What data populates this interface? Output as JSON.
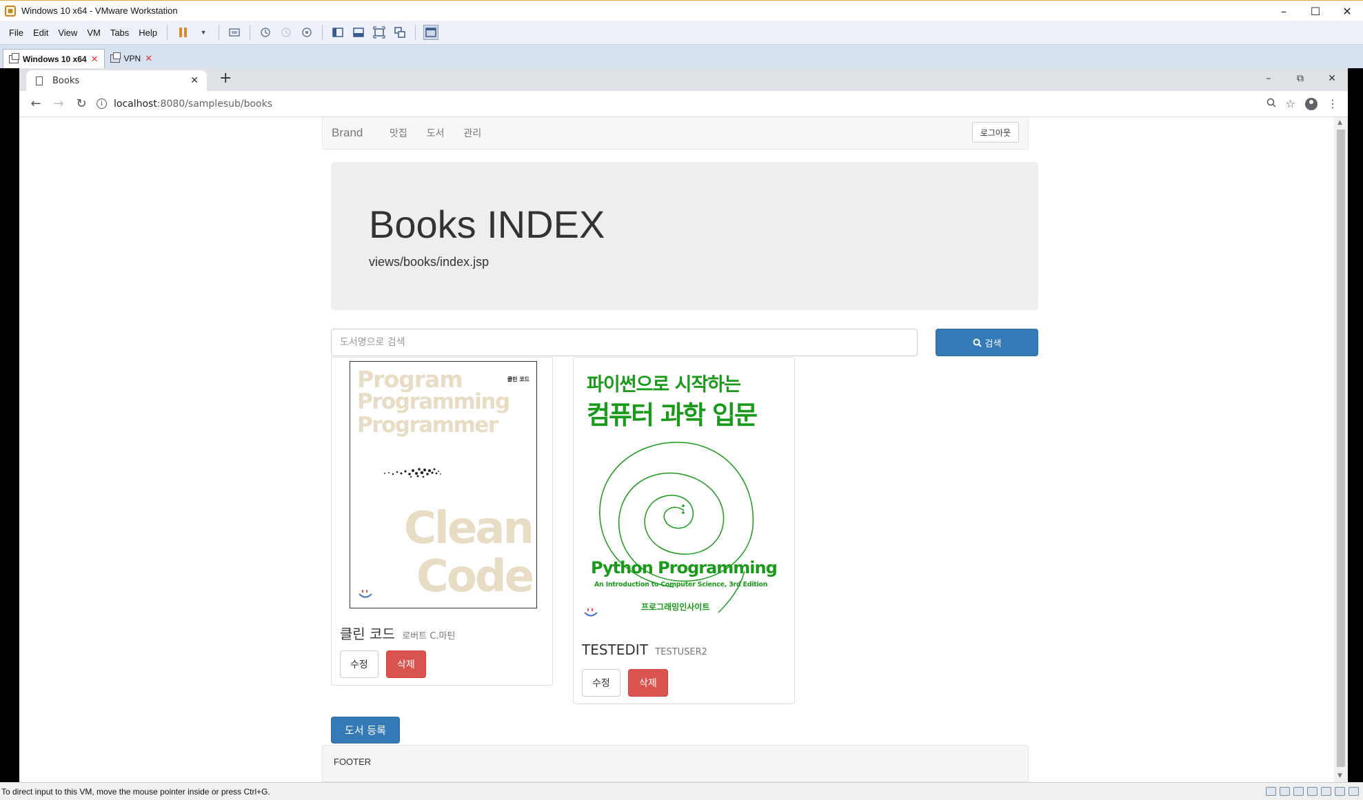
{
  "vmware": {
    "title": "Windows 10 x64 - VMware Workstation",
    "menu": [
      "File",
      "Edit",
      "View",
      "VM",
      "Tabs",
      "Help"
    ],
    "tabs": [
      {
        "label": "Windows 10 x64",
        "active": true
      },
      {
        "label": "VPN",
        "active": false
      }
    ],
    "status_text": "To direct input to this VM, move the mouse pointer inside or press Ctrl+G."
  },
  "browser": {
    "tab_title": "Books",
    "url_host": "localhost",
    "url_rest": ":8080/samplesub/books"
  },
  "navbar": {
    "brand": "Brand",
    "links": [
      "맛집",
      "도서",
      "관리"
    ],
    "logout": "로그아웃"
  },
  "jumbotron": {
    "title": "Books INDEX",
    "subtitle": "views/books/index.jsp"
  },
  "search": {
    "placeholder": "도서명으로 검색",
    "button": "검색"
  },
  "books": [
    {
      "title": "클린 코드",
      "author": "로버트 C.마틴",
      "cover_lines": [
        "Program",
        "Programming",
        "Programmer",
        "Clean",
        "Code"
      ],
      "cover_small": "클린 코드",
      "edit": "수정",
      "delete": "삭제"
    },
    {
      "title": "TESTEDIT",
      "author": "TESTUSER2",
      "cover_lines": [
        "파이썬으로 시작하는",
        "컴퓨터 과학 입문",
        "Python Programming",
        "An Introduction to Computer Science, 3rd Edition",
        "프로그래밍인사이트"
      ],
      "edit": "수정",
      "delete": "삭제"
    }
  ],
  "register_button": "도서 등록",
  "footer": "FOOTER",
  "colors": {
    "primary": "#337ab7",
    "danger": "#d9534f",
    "cover_green": "#1a9a1a",
    "cover_beige": "#e8dcc4"
  }
}
